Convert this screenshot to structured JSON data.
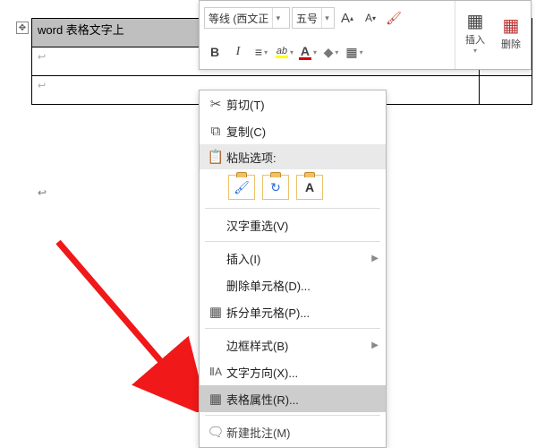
{
  "doc": {
    "cell_text": "word 表格文字上",
    "para_mark": "↩"
  },
  "mini_toolbar": {
    "font_name": "等线 (西文正",
    "font_size": "五号",
    "grow_font": "A",
    "shrink_font": "A",
    "format_painter": "✎",
    "bold": "B",
    "italic": "I",
    "align": "≡",
    "highlight": "ab",
    "font_color": "A",
    "shading": "◇",
    "borders": "▦",
    "insert": {
      "icon": "▦",
      "label": "插入"
    },
    "delete": {
      "icon": "▦",
      "label": "删除"
    }
  },
  "context_menu": {
    "cut": "剪切(T)",
    "copy": "复制(C)",
    "paste_header": "粘贴选项:",
    "paste_options": [
      "keep-source",
      "merge",
      "text-only"
    ],
    "reconvert": "汉字重选(V)",
    "insert": "插入(I)",
    "delete_cells": "删除单元格(D)...",
    "split_cells": "拆分单元格(P)...",
    "border_style": "边框样式(B)",
    "text_direction": "文字方向(X)...",
    "table_props": "表格属性(R)...",
    "new_comment": "新建批注(M)"
  }
}
